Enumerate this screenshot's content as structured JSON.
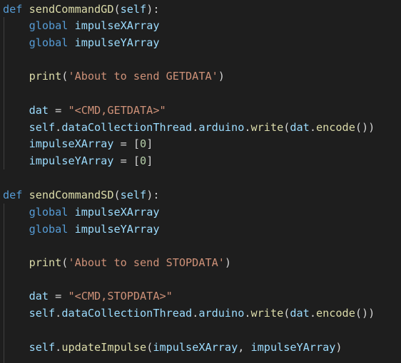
{
  "code": {
    "fn1": {
      "def_kw": "def",
      "name": "sendCommandGD",
      "params_open": "(",
      "self": "self",
      "params_close": "):",
      "global_kw_1": "global",
      "global_var_1": "impulseXArray",
      "global_kw_2": "global",
      "global_var_2": "impulseYArray",
      "print_fn": "print",
      "print_open": "(",
      "print_str": "'About to send GETDATA'",
      "print_close": ")",
      "dat_var": "dat",
      "dat_eq": " = ",
      "dat_str": "\"<CMD,GETDATA>\"",
      "write_self": "self",
      "write_dot1": ".",
      "write_thread": "dataCollectionThread",
      "write_dot2": ".",
      "write_arduino": "arduino",
      "write_dot3": ".",
      "write_fn": "write",
      "write_open": "(",
      "write_dat": "dat",
      "write_dot4": ".",
      "encode_fn": "encode",
      "write_close": "())",
      "x_var": "impulseXArray",
      "x_eq": " = [",
      "x_num": "0",
      "x_close": "]",
      "y_var": "impulseYArray",
      "y_eq": " = [",
      "y_num": "0",
      "y_close": "]"
    },
    "fn2": {
      "def_kw": "def",
      "name": "sendCommandSD",
      "params_open": "(",
      "self": "self",
      "params_close": "):",
      "global_kw_1": "global",
      "global_var_1": "impulseXArray",
      "global_kw_2": "global",
      "global_var_2": "impulseYArray",
      "print_fn": "print",
      "print_open": "(",
      "print_str": "'About to send STOPDATA'",
      "print_close": ")",
      "dat_var": "dat",
      "dat_eq": " = ",
      "dat_str": "\"<CMD,STOPDATA>\"",
      "write_self": "self",
      "write_dot1": ".",
      "write_thread": "dataCollectionThread",
      "write_dot2": ".",
      "write_arduino": "arduino",
      "write_dot3": ".",
      "write_fn": "write",
      "write_open": "(",
      "write_dat": "dat",
      "write_dot4": ".",
      "encode_fn": "encode",
      "write_close": "())",
      "upd_self": "self",
      "upd_dot": ".",
      "upd_fn": "updateImpulse",
      "upd_open": "(",
      "upd_arg1": "impulseXArray",
      "upd_comma": ", ",
      "upd_arg2": "impulseYArray",
      "upd_close": ")"
    }
  },
  "theme": {
    "background": "#1e1e1e",
    "keyword": "#569cd6",
    "function": "#dcdcaa",
    "variable": "#9cdcfe",
    "string": "#ce9178",
    "number": "#b5cea8",
    "punctuation": "#d4d4d4",
    "indent_guide": "#404040"
  }
}
